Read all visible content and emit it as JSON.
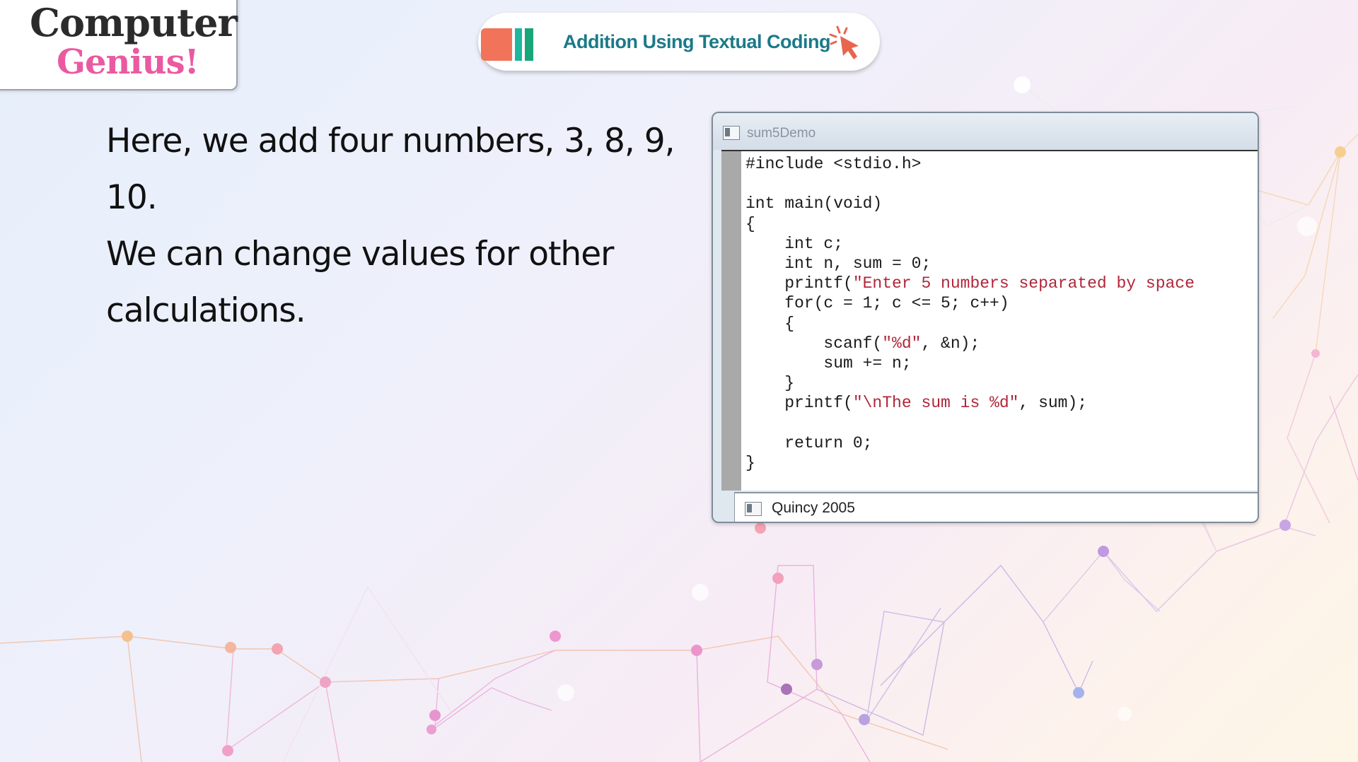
{
  "logo": {
    "line1": "Computer",
    "line2": "Genius!"
  },
  "header": {
    "title": "Addition Using Textual Coding",
    "cursor_icon": "click-cursor-icon"
  },
  "body_text": [
    "Here, we add four numbers, 3, 8, 9, 10.",
    "We can change values for other",
    "calculations."
  ],
  "code_window": {
    "title": "sum5Demo",
    "status": "Quincy 2005",
    "lines": [
      [
        {
          "t": "#include <stdio.h>"
        }
      ],
      [
        {
          "t": ""
        }
      ],
      [
        {
          "t": "int main(void)"
        }
      ],
      [
        {
          "t": "{"
        }
      ],
      [
        {
          "t": "    int c;"
        }
      ],
      [
        {
          "t": "    int n, sum = 0;"
        }
      ],
      [
        {
          "t": "    printf("
        },
        {
          "t": "\"Enter 5 numbers separated by space",
          "s": true
        }
      ],
      [
        {
          "t": "    for(c = 1; c <= 5; c++)"
        }
      ],
      [
        {
          "t": "    {"
        }
      ],
      [
        {
          "t": "        scanf("
        },
        {
          "t": "\"%d\"",
          "s": true
        },
        {
          "t": ", &n);"
        }
      ],
      [
        {
          "t": "        sum += n;"
        }
      ],
      [
        {
          "t": "    }"
        }
      ],
      [
        {
          "t": "    printf("
        },
        {
          "t": "\"\\nThe sum is %d\"",
          "s": true
        },
        {
          "t": ", sum);"
        }
      ],
      [
        {
          "t": ""
        }
      ],
      [
        {
          "t": "    return 0;"
        }
      ],
      [
        {
          "t": "}"
        }
      ]
    ]
  },
  "colors": {
    "logo_pink": "#ea5aa0",
    "title_teal": "#1b7a88",
    "accent_orange": "#f0735a",
    "accent_teal": "#1fb6a0",
    "string_red": "#b0263a"
  }
}
